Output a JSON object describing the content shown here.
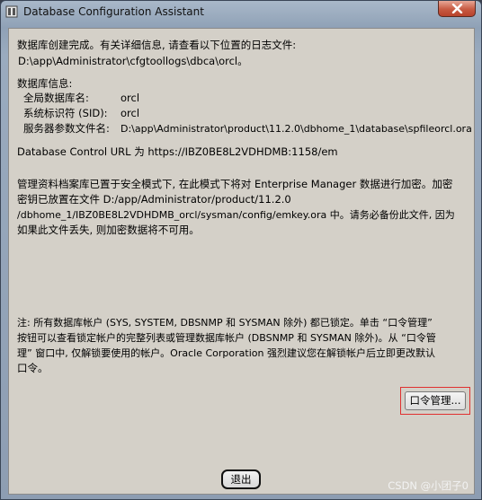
{
  "window": {
    "title": "Database Configuration Assistant"
  },
  "messages": {
    "created_line1": "数据库创建完成。有关详细信息, 请查看以下位置的日志文件:",
    "created_line2": "D:\\app\\Administrator\\cfgtoollogs\\dbca\\orcl。",
    "info_heading": "数据库信息:",
    "info_rows": [
      {
        "label": "全局数据库名:",
        "value": "orcl"
      },
      {
        "label": "系统标识符 (SID):",
        "value": "orcl"
      },
      {
        "label": "服务器参数文件名:",
        "value": "D:\\app\\Administrator\\product\\11.2.0\\dbhome_1\\database\\spfileorcl.ora"
      }
    ],
    "dbcontrol": "Database Control URL 为 https://IBZ0BE8L2VDHDMB:1158/em",
    "security_lines": [
      "管理资料档案库已置于安全模式下, 在此模式下将对 Enterprise Manager 数据进行加密。加密",
      "密钥已放置在文件 D:/app/Administrator/product/11.2.0",
      "/dbhome_1/IBZ0BE8L2VDHDMB_orcl/sysman/config/emkey.ora 中。请务必备份此文件, 因为",
      "如果此文件丢失, 则加密数据将不可用。"
    ],
    "note_lines": [
      "注: 所有数据库帐户 (SYS, SYSTEM, DBSNMP 和 SYSMAN 除外) 都已锁定。单击 “口令管理”",
      "按钮可以查看锁定帐户的完整列表或管理数据库帐户 (DBSNMP 和 SYSMAN 除外)。从 “口令管",
      "理” 窗口中, 仅解锁要使用的帐户。Oracle Corporation 强烈建议您在解锁帐户后立即更改默认",
      "口令。"
    ]
  },
  "buttons": {
    "password_mgmt": "口令管理...",
    "exit": "退出"
  },
  "watermark": "CSDN @小团子0",
  "colors": {
    "dialog_bg": "#d4d0c8",
    "close_red": "#c75a42",
    "highlight_red": "#e03030"
  }
}
